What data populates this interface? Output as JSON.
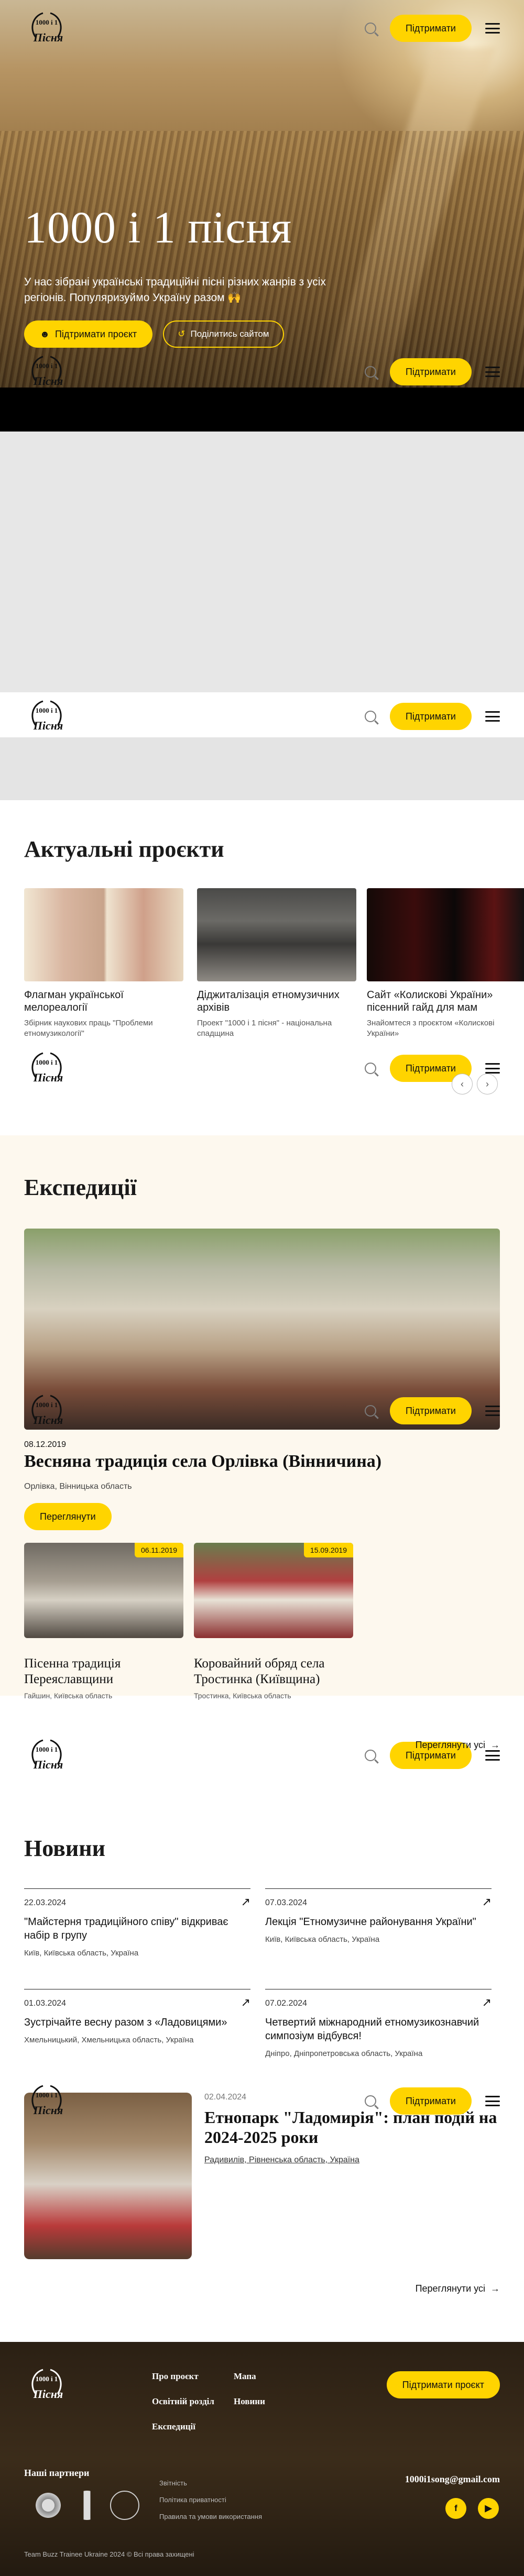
{
  "header": {
    "support_label": "Підтримати"
  },
  "logo": {
    "top_text": "1000 і 1",
    "bottom_text": "Пісня"
  },
  "hero": {
    "title": "1000 і 1 пісня",
    "text": "У нас зібрані українські традиційні пісні різних жанрів з усіх регіонів. Популяризуймо Україну разом 🙌",
    "support_project_label": "Підтримати проєкт",
    "share_label": "Поділитись сайтом"
  },
  "projects": {
    "title": "Актуальні проєкти",
    "items": [
      {
        "title": "Флагман української мелореалогії",
        "desc": "Збірник наукових праць \"Проблеми етномузикології\""
      },
      {
        "title": "Діджиталізація етномузичних архівів",
        "desc": "Проект \"1000 і 1 пісня\" - національна спадщина"
      },
      {
        "title": "Сайт «Колискові України» пісенний гайд для мам",
        "desc": "Знайомтеся з проєктом «Колискові України»"
      }
    ]
  },
  "expeditions": {
    "title": "Експедиції",
    "main": {
      "date": "08.12.2019",
      "title": "Весняна традиція села Орлівка (Вінничина)",
      "location": "Орлівка, Вінницька область",
      "button": "Переглянути"
    },
    "cards": [
      {
        "date": "06.11.2019",
        "title": "Пісенна традиція Переяславщини",
        "location": "Гайшин, Київська область"
      },
      {
        "date": "15.09.2019",
        "title": "Коровайний обряд села Тростинка (Київщина)",
        "location": "Тростинка, Київська область"
      }
    ],
    "see_all": "Переглянути усі"
  },
  "news": {
    "title": "Новини",
    "items": [
      {
        "date": "22.03.2024",
        "title": "\"Майстерня традиційного співу\" відкриває набір в групу",
        "location": "Київ, Київська область, Україна"
      },
      {
        "date": "07.03.2024",
        "title": "Лекція \"Етномузичне районування України\"",
        "location": "Київ, Київська область, Україна"
      },
      {
        "date": "01.03.2024",
        "title": "Зустрічайте весну разом з «Ладовицями»",
        "location": "Хмельницький, Хмельницька область, Україна"
      },
      {
        "date": "07.02.2024",
        "title": "Четвертий міжнародний етномузикознавчий симпозіум відбувся!",
        "location": "Дніпро, Дніпропетровська область, Україна"
      }
    ],
    "feature": {
      "date": "02.04.2024",
      "title": "Етнопарк \"Ладомирія\": план подій на 2024-2025 роки",
      "location": "Радивилів, Рівненська область, Україна"
    },
    "see_all": "Переглянути усі"
  },
  "footer": {
    "nav": [
      "Про проєкт",
      "Мапа",
      "Освітній розділ",
      "Новини",
      "Експедиції"
    ],
    "support_project_label": "Підтримати проєкт",
    "partners_title": "Наші партнери",
    "legal": [
      "Звітність",
      "Політика приватності",
      "Правила та умови використання"
    ],
    "email": "1000i1song@gmail.com",
    "copyright": "Team Buzz Trainee Ukraine 2024 © Всі права захищені"
  }
}
